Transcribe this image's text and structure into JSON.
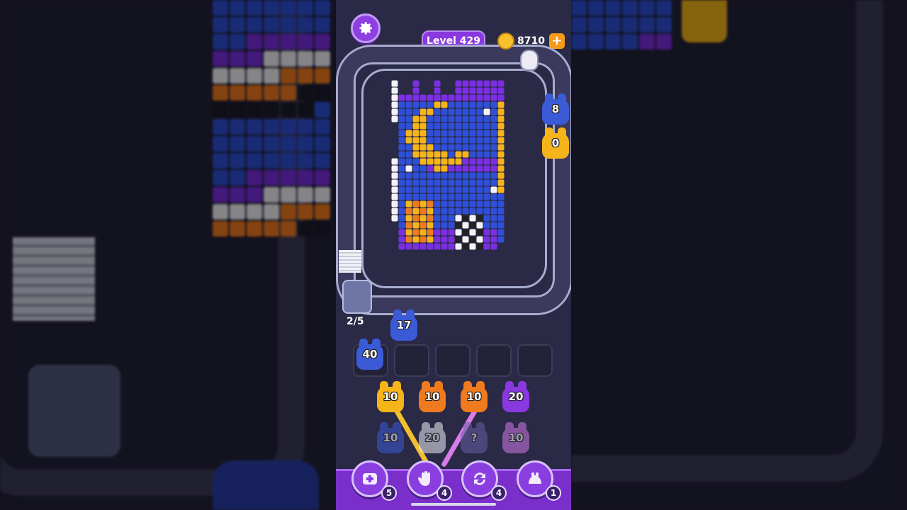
{
  "header": {
    "level_label": "Level 429",
    "coins": "8710",
    "add_coins": "+"
  },
  "conveyor": {
    "queue_progress": "2/5",
    "incoming_unit_count": "17",
    "active_unit_count": "40"
  },
  "side_units": [
    {
      "count": "8",
      "color": "#3b5bd6"
    },
    {
      "count": "0",
      "color": "#f5b41a"
    }
  ],
  "grid_units": [
    {
      "count": "10",
      "color": "#f5b41a"
    },
    {
      "count": "10",
      "color": "#f07a1e"
    },
    {
      "count": "10",
      "color": "#f07a1e"
    },
    {
      "count": "20",
      "color": "#8a38df"
    },
    {
      "count": "10",
      "color": "#3b5bd6"
    },
    {
      "count": "20",
      "color": "#f0f0f5"
    },
    {
      "count": "?",
      "color": "#6a5fa8"
    },
    {
      "count": "10",
      "color": "#d07ae8"
    }
  ],
  "tools": [
    {
      "icon": "add-slot-icon",
      "count": "5"
    },
    {
      "icon": "hand-icon",
      "count": "4"
    },
    {
      "icon": "shuffle-icon",
      "count": "4"
    },
    {
      "icon": "magnet-icon",
      "count": "1"
    }
  ],
  "colors": {
    "accent_purple": "#8a38df",
    "board_bg": "#2a2946",
    "track": "#3b3a5c",
    "pixel_blue": "#2e4fd6",
    "pixel_purple": "#7a2fe0",
    "pixel_yellow": "#f5b41a",
    "pixel_white": "#f2f2f7"
  }
}
